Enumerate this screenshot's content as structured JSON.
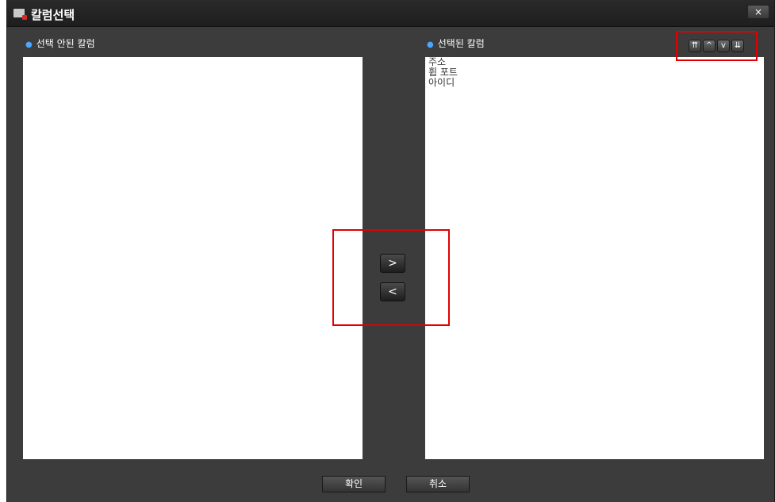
{
  "window": {
    "title": "칼럼선택",
    "close_label": "×"
  },
  "left_panel": {
    "label": "선택 안된 칼럼",
    "items": []
  },
  "right_panel": {
    "label": "선택된 칼럼",
    "items": [
      "주소",
      "휩 포트",
      "아이디"
    ]
  },
  "order_buttons": {
    "top": "⇈",
    "up": "^",
    "down": "v",
    "bottom": "⇊"
  },
  "move_buttons": {
    "add": ">",
    "remove": "<"
  },
  "footer": {
    "ok_label": "확인",
    "cancel_label": "취소"
  },
  "colors": {
    "dialog_bg": "#3c3c3c",
    "highlight": "#e00000",
    "bullet": "#4aa6ff"
  }
}
